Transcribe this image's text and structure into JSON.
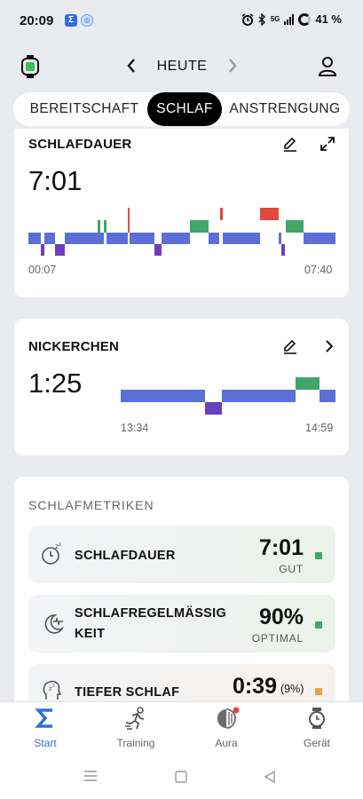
{
  "status_bar": {
    "time": "20:09",
    "sigma_glyph": "Σ",
    "battery": "41 %",
    "network": "5G",
    "icons": [
      "alarm-icon",
      "bluetooth-icon",
      "signal-icon",
      "battery-icon"
    ]
  },
  "header": {
    "title": "HEUTE",
    "prev_icon": "chevron-left-icon",
    "next_icon": "chevron-right-icon"
  },
  "tabs": [
    {
      "label": "BEREITSCHAFT",
      "active": false
    },
    {
      "label": "SCHLAF",
      "active": true
    },
    {
      "label": "ANSTRENGUNG",
      "active": false
    }
  ],
  "sleep_card": {
    "title": "SCHLAFDAUER",
    "duration": "7:01",
    "start": "00:07",
    "end": "07:40"
  },
  "nap_card": {
    "title": "NICKERCHEN",
    "duration": "1:25",
    "start": "13:34",
    "end": "14:59"
  },
  "metrics": {
    "title": "SCHLAFMETRIKEN",
    "items": [
      {
        "label": "SCHLAFDAUER",
        "value": "7:01",
        "suffix": "",
        "rating": "GUT",
        "status_color": "#3fa76a",
        "icon": "clock-sleep-icon"
      },
      {
        "label_line1": "SCHLAFREGELMÄSSIG",
        "label_line2": "KEIT",
        "value": "90%",
        "suffix": "",
        "rating": "OPTIMAL",
        "status_color": "#3fa76a",
        "icon": "moon-heartbeat-icon"
      },
      {
        "label": "TIEFER SCHLAF",
        "value": "0:39",
        "suffix": "(9%)",
        "rating": "",
        "status_color": "#e8a24a",
        "icon": "head-sleep-icon"
      }
    ]
  },
  "bottom_nav": [
    {
      "label": "Start",
      "active": true,
      "icon": "sigma-icon"
    },
    {
      "label": "Training",
      "active": false,
      "icon": "running-icon"
    },
    {
      "label": "Aura",
      "active": false,
      "icon": "aura-icon"
    },
    {
      "label": "Gerät",
      "active": false,
      "icon": "watch-icon"
    }
  ],
  "colors": {
    "accent": "#2f6fd8",
    "light_sleep": "#5b6fd6",
    "deep_sleep": "#6a3fbc",
    "rem": "#3fa76a",
    "awake": "#e04a3c"
  }
}
